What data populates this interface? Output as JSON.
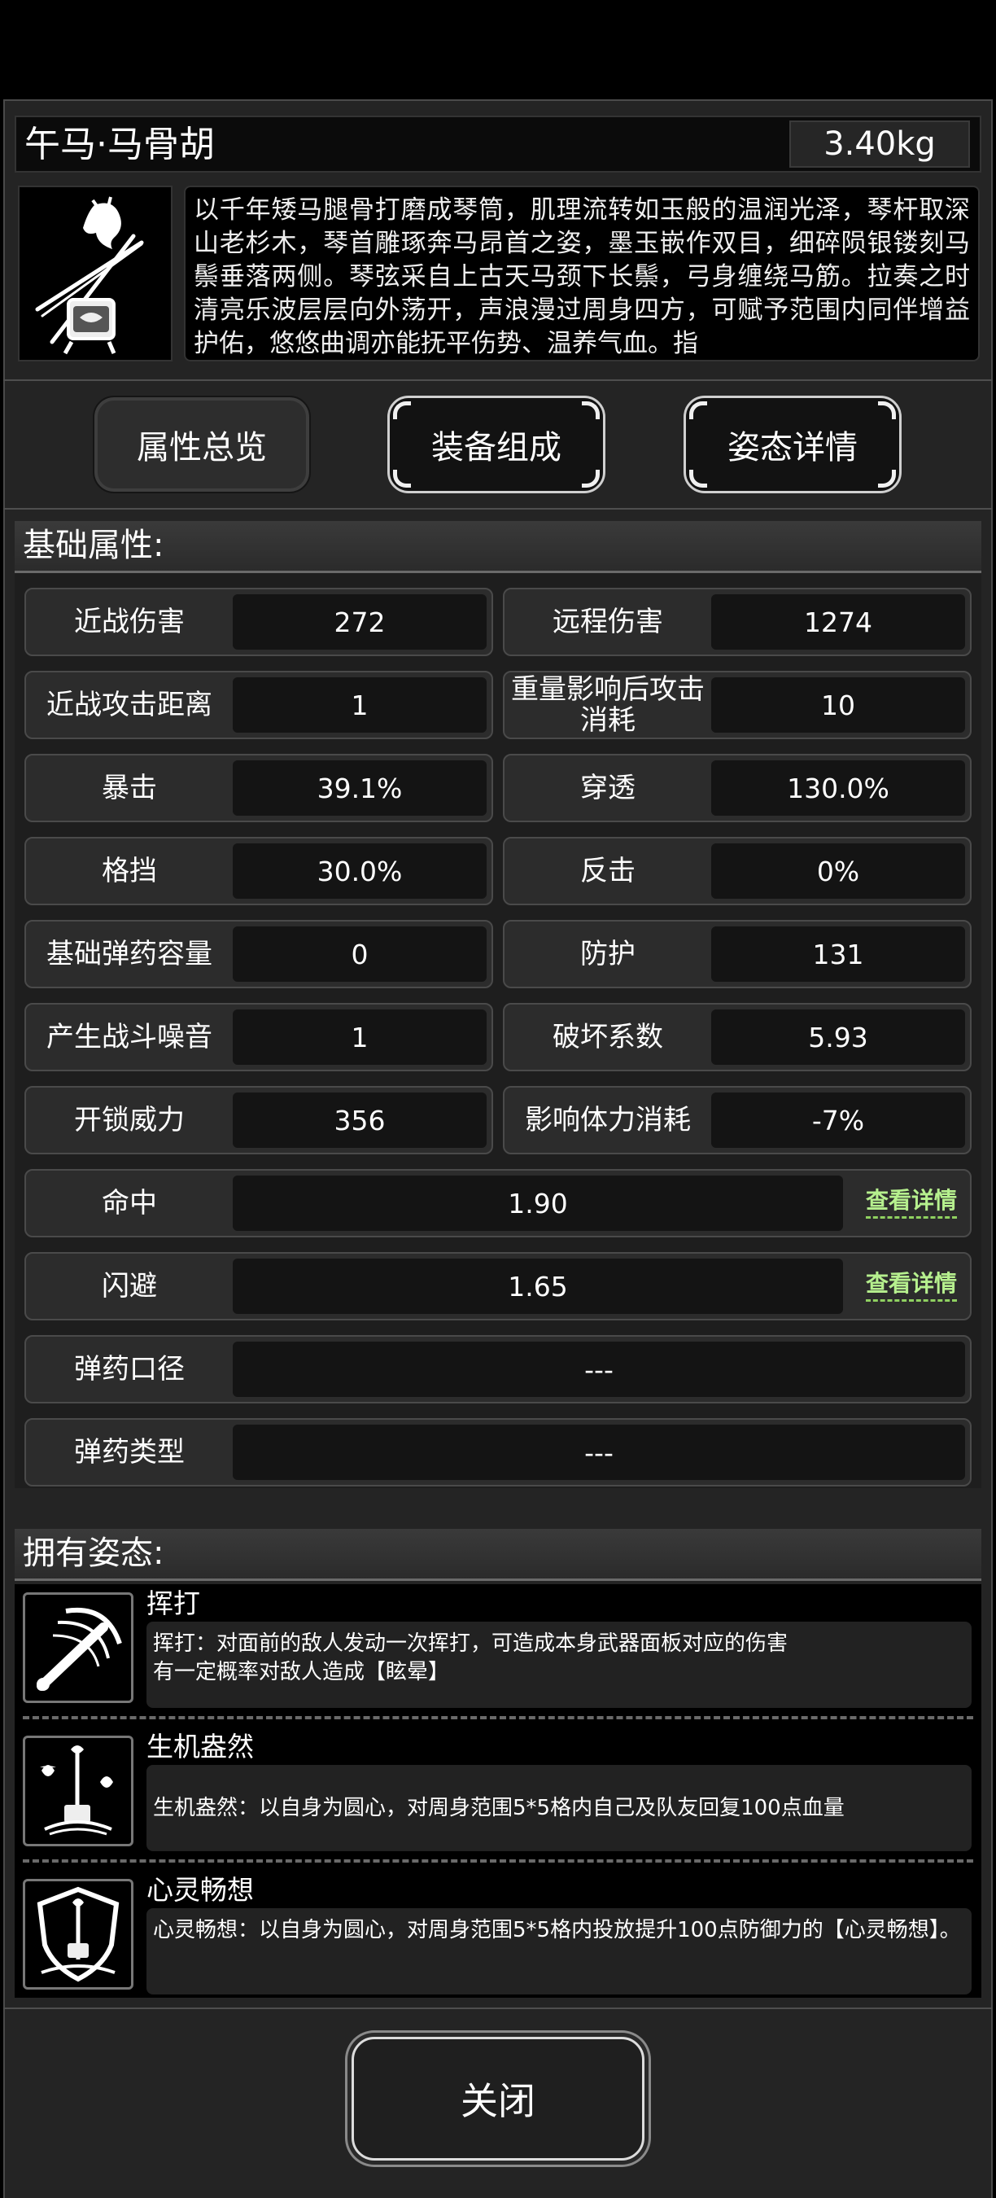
{
  "item": {
    "name": "午马·马骨胡",
    "weight": "3.40kg",
    "description": "以千年矮马腿骨打磨成琴筒，肌理流转如玉般的温润光泽，琴杆取深山老杉木，琴首雕琢奔马昂首之姿，墨玉嵌作双目，细碎陨银镂刻马鬃垂落两侧。琴弦采自上古天马颈下长鬃，弓身缠绕马筋。拉奏之时清亮乐波层层向外荡开，声浪漫过周身四方，可赋予范围内同伴增益护佑，悠悠曲调亦能抚平伤势、温养气血。指",
    "icon": "horse-head-erhu-icon"
  },
  "tabs": [
    {
      "label": "属性总览",
      "active": true
    },
    {
      "label": "装备组成",
      "active": false
    },
    {
      "label": "姿态详情",
      "active": false
    }
  ],
  "base_attributes": {
    "title": "基础属性:",
    "pairs": [
      {
        "left_label": "近战伤害",
        "left_value": "272",
        "right_label": "远程伤害",
        "right_value": "1274"
      },
      {
        "left_label": "近战攻击距离",
        "left_value": "1",
        "right_label": "重量影响后攻击消耗",
        "right_value": "10"
      },
      {
        "left_label": "暴击",
        "left_value": "39.1%",
        "right_label": "穿透",
        "right_value": "130.0%"
      },
      {
        "left_label": "格挡",
        "left_value": "30.0%",
        "right_label": "反击",
        "right_value": "0%"
      },
      {
        "left_label": "基础弹药容量",
        "left_value": "0",
        "right_label": "防护",
        "right_value": "131"
      },
      {
        "left_label": "产生战斗噪音",
        "left_value": "1",
        "right_label": "破坏系数",
        "right_value": "5.93"
      },
      {
        "left_label": "开锁威力",
        "left_value": "356",
        "right_label": "影响体力消耗",
        "right_value": "-7%"
      }
    ],
    "rows": [
      {
        "label": "命中",
        "value": "1.90",
        "link": "查看详情"
      },
      {
        "label": "闪避",
        "value": "1.65",
        "link": "查看详情"
      },
      {
        "label": "弹药口径",
        "value": "---"
      },
      {
        "label": "弹药类型",
        "value": "---"
      }
    ]
  },
  "stances": {
    "title": "拥有姿态:",
    "items": [
      {
        "name": "挥打",
        "desc": "挥打：对面前的敌人发动一次挥打，可造成本身武器面板对应的伤害",
        "desc2": "有一定概率对敌人造成【眩晕】",
        "icon": "swing-strike-icon"
      },
      {
        "name": "生机盎然",
        "desc": "生机盎然：以自身为圆心，对周身范围5*5格内自己及队友回复100点血量",
        "desc2": "",
        "icon": "vitality-erhu-icon"
      },
      {
        "name": "心灵畅想",
        "desc": "心灵畅想：以自身为圆心，对周身范围5*5格内投放提升100点防御力的【心灵畅想】。",
        "desc2": "",
        "icon": "shield-erhu-icon"
      }
    ]
  },
  "close_label": "关闭"
}
